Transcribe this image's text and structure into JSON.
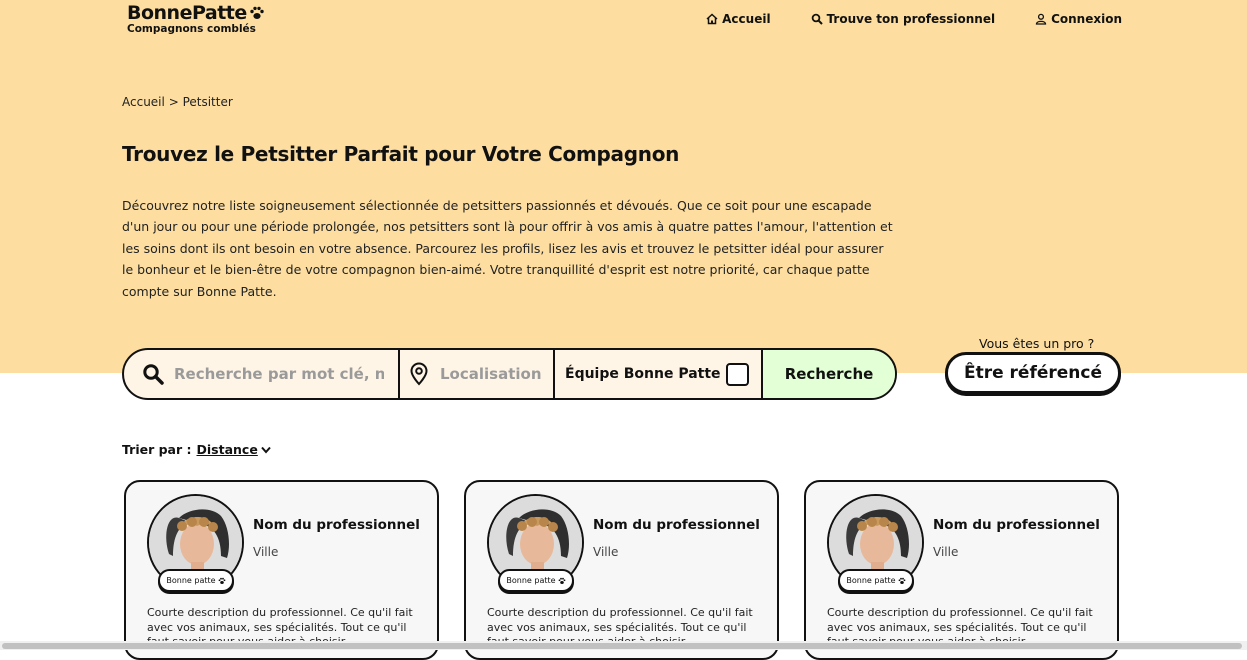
{
  "brand": {
    "name": "BonnePatte",
    "tagline": "Compagnons comblés"
  },
  "nav": [
    {
      "label": "Accueil",
      "icon": "home-icon"
    },
    {
      "label": "Trouve ton professionnel",
      "icon": "search-icon"
    },
    {
      "label": "Connexion",
      "icon": "user-icon"
    }
  ],
  "breadcrumb": {
    "home": "Accueil",
    "separator": ">",
    "current": "Petsitter"
  },
  "page": {
    "title": "Trouvez le Petsitter Parfait pour Votre Compagnon",
    "intro": "Découvrez notre liste soigneusement sélectionnée de petsitters passionnés et dévoués. Que ce soit pour une escapade d'un jour ou pour une période prolongée, nos petsitters sont là pour offrir à vos amis à quatre pattes l'amour, l'attention et les soins dont ils ont besoin en votre absence. Parcourez les profils, lisez les avis et trouvez le petsitter idéal pour assurer le bonheur et le bien-être de votre compagnon bien-aimé. Votre tranquillité d'esprit est notre priorité, car chaque patte compte sur Bonne Patte."
  },
  "search": {
    "keyword_placeholder": "Recherche par mot clé, nom...",
    "location_placeholder": "Localisation",
    "team_label": "Équipe Bonne Patte",
    "submit_label": "Recherche"
  },
  "pro_cta": {
    "question": "Vous êtes un pro ?",
    "button": "Être référencé"
  },
  "sort": {
    "label": "Trier par :",
    "value": "Distance"
  },
  "cards": [
    {
      "name": "Nom du professionnel",
      "city": "Ville",
      "badge": "Bonne patte",
      "description": "Courte description du professionnel. Ce qu'il fait avec vos animaux, ses spécialités. Tout ce qu'il faut savoir pour vous aider à choisir."
    },
    {
      "name": "Nom du professionnel",
      "city": "Ville",
      "badge": "Bonne patte",
      "description": "Courte description du professionnel. Ce qu'il fait avec vos animaux, ses spécialités. Tout ce qu'il faut savoir pour vous aider à choisir."
    },
    {
      "name": "Nom du professionnel",
      "city": "Ville",
      "badge": "Bonne patte",
      "description": "Courte description du professionnel. Ce qu'il fait avec vos animaux, ses spécialités. Tout ce qu'il faut savoir pour vous aider à choisir."
    }
  ],
  "colors": {
    "hero_bg": "#fddea0",
    "search_bg": "#fff5e6",
    "search_button_bg": "#e2ffd6",
    "card_bg": "#f7f7f7"
  }
}
